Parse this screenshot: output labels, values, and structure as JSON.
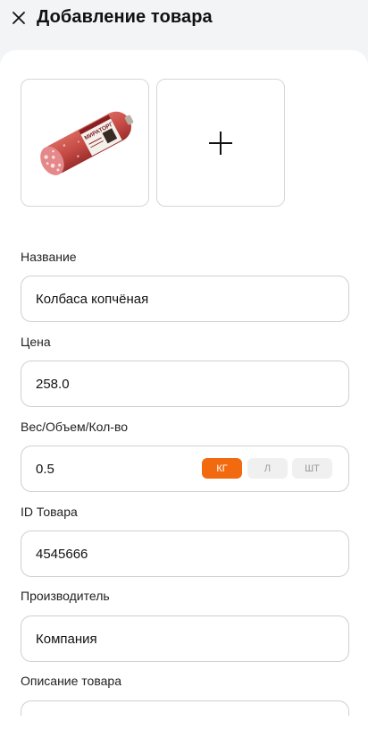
{
  "header": {
    "title": "Добавление товара",
    "close_icon": "close-icon"
  },
  "photos": {
    "product_image": "product-photo",
    "add_icon": "plus-icon",
    "product_label_text": "МИРАТОРГ"
  },
  "form": {
    "name": {
      "label": "Название",
      "value": "Колбаса копчёная"
    },
    "price": {
      "label": "Цена",
      "value": "258.0"
    },
    "weight": {
      "label": "Вес/Объем/Кол-во",
      "value": "0.5",
      "units": [
        "КГ",
        "Л",
        "ШТ"
      ],
      "selected_unit": "КГ"
    },
    "product_id": {
      "label": "ID Товара",
      "value": "4545666"
    },
    "manufacturer": {
      "label": "Производитель",
      "value": "Компания"
    },
    "description": {
      "label": "Описание товара",
      "value": ""
    }
  },
  "colors": {
    "accent": "#f26a0f",
    "chip_inactive": "#f0f0f0",
    "border": "#cfcfcf"
  }
}
